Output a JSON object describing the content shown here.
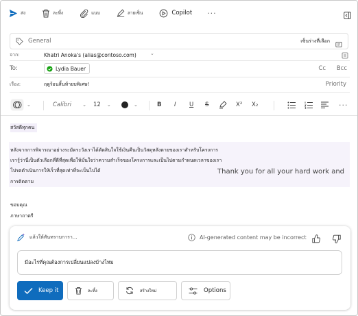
{
  "colors": {
    "accent": "#0f6cbd",
    "chip_status": "#13a10e",
    "highlight": "#f6f3fb",
    "send_icon": "#0f6cbd"
  },
  "toolbar": {
    "send_label": "ส่ง",
    "discard_label": "ละทิ้ง",
    "attach_label": "แนบ",
    "signature_label": "ลายเซ็น",
    "copilot_label": "Copilot",
    "more_label": "···"
  },
  "sensitivity": {
    "label": "General",
    "draft_label": "เซ็นร่างที่เลือก"
  },
  "header": {
    "from_label": "จาก:",
    "from_value": "Khatri Anoka's (alias@contoso.com)",
    "to_label": "To:",
    "to_recipient": "Lydia Bauer",
    "cc_label": "Cc",
    "bcc_label": "Bcc",
    "subject_label": "เรื่อง:",
    "subject_value": "ฤดูร้อนสิ้นท้ายบพิเศษ!",
    "priority_label": "Priority"
  },
  "format": {
    "font": "Calibri",
    "size": "12",
    "bold": "B",
    "italic": "I",
    "underline": "U",
    "strikethrough": "S",
    "superscript": "X²",
    "subscript": "X₂",
    "more": "···"
  },
  "body": {
    "greeting": "สวัสดีทุกคน",
    "para_line1": "หลังจากการพิจารณาอย่างระมัดระวังเราได้ตัดสินใจใช้เงินคืนเป็นวัสดุหลังตายของเราสำหรับโครงการ",
    "para_line2": "เรารู้ว่านี่เป็นตัวเลือกที่ดีที่สุดเพื่อให้มั่นใจว่าความสำเร็จของโครงการและเป็นไปตามกำหนดเวลาของเรา",
    "para_line3": "โปรดดำเนินการให้เร็วที่สุดเท่าที่จะเป็นไปได้",
    "para_line4": "การติดตาม",
    "ghost_text": "Thank you for all your hard work and",
    "closing": "ขอบคุณ",
    "signature": "ภาษาถาตรี"
  },
  "copilot_panel": {
    "title": "แล้วให้ทันทราบการา...",
    "disclaimer": "AI-generated content may be incorrect",
    "prompt_text": "มีอะไรที่คุณต้องการเปลี่ยนแปลงบ้างไหม",
    "keep_label": "Keep it",
    "discard_label": "ละทิ้ง",
    "regenerate_label": "สร้างใหม่",
    "options_label": "Options"
  }
}
